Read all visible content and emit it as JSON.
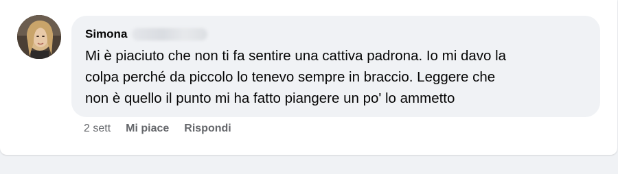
{
  "comment": {
    "author_name": "Simona",
    "text": "Mi è piaciuto che non ti fa sentire una cattiva padrona. Io mi davo la\ncolpa perché da piccolo lo tenevo sempre in braccio. Leggere che\nnon è quello il punto mi ha fatto piangere un po' lo ammetto",
    "timestamp": "2 sett",
    "like_label": "Mi piace",
    "reply_label": "Rispondi"
  },
  "colors": {
    "bubble_background": "#f0f2f5",
    "secondary_text": "#65676b",
    "primary_text": "#050505"
  }
}
